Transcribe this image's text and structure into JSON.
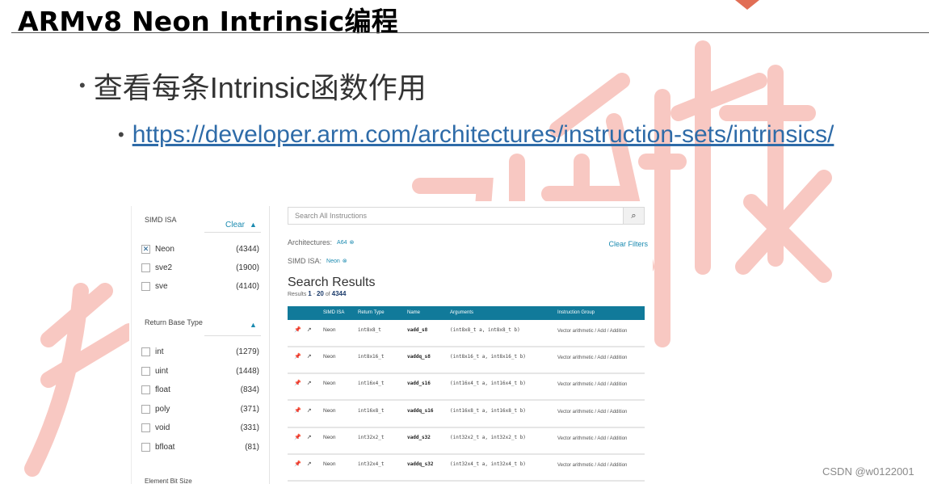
{
  "slide": {
    "title": "ARMv8 Neon Intrinsic编程",
    "bullet_1": "查看每条Intrinsic函数作用",
    "bullet_2_link": "https://developer.arm.com/architectures/instruction-sets/intrinsics/"
  },
  "watermark": {
    "csdn": "CSDN @w0122001"
  },
  "filters": {
    "simd_isa_label": "SIMD ISA",
    "clear_label": "Clear",
    "simd_items": [
      {
        "label": "Neon",
        "count": "(4344)",
        "checked": true
      },
      {
        "label": "sve2",
        "count": "(1900)",
        "checked": false
      },
      {
        "label": "sve",
        "count": "(4140)",
        "checked": false
      }
    ],
    "return_type_label": "Return Base Type",
    "return_items": [
      {
        "label": "int",
        "count": "(1279)"
      },
      {
        "label": "uint",
        "count": "(1448)"
      },
      {
        "label": "float",
        "count": "(834)"
      },
      {
        "label": "poly",
        "count": "(371)"
      },
      {
        "label": "void",
        "count": "(331)"
      },
      {
        "label": "bfloat",
        "count": "(81)"
      }
    ],
    "cut_label": "Element Bit Size"
  },
  "results": {
    "search_placeholder": "Search All Instructions",
    "architectures_label": "Architectures:",
    "arch_chip": "A64",
    "simd_label": "SIMD ISA:",
    "simd_chip": "Neon",
    "clear_filters": "Clear Filters",
    "title": "Search Results",
    "count_prefix": "Results",
    "count_from": "1",
    "count_dash": " - ",
    "count_to": "20",
    "count_of": " of ",
    "count_total": "4344",
    "columns": [
      "SIMD ISA",
      "Return Type",
      "Name",
      "Arguments",
      "Instruction Group"
    ],
    "rows": [
      {
        "isa": "Neon",
        "ret": "int8x8_t",
        "name": "vadd_s8",
        "args": "(int8x8_t a, int8x8_t b)",
        "group": "Vector arithmetic / Add / Addition"
      },
      {
        "isa": "Neon",
        "ret": "int8x16_t",
        "name": "vaddq_s8",
        "args": "(int8x16_t a, int8x16_t b)",
        "group": "Vector arithmetic / Add / Addition"
      },
      {
        "isa": "Neon",
        "ret": "int16x4_t",
        "name": "vadd_s16",
        "args": "(int16x4_t a, int16x4_t b)",
        "group": "Vector arithmetic / Add / Addition"
      },
      {
        "isa": "Neon",
        "ret": "int16x8_t",
        "name": "vaddq_s16",
        "args": "(int16x8_t a, int16x8_t b)",
        "group": "Vector arithmetic / Add / Addition"
      },
      {
        "isa": "Neon",
        "ret": "int32x2_t",
        "name": "vadd_s32",
        "args": "(int32x2_t a, int32x2_t b)",
        "group": "Vector arithmetic / Add / Addition"
      },
      {
        "isa": "Neon",
        "ret": "int32x4_t",
        "name": "vaddq_s32",
        "args": "(int32x4_t a, int32x4_t b)",
        "group": "Vector arithmetic / Add / Addition"
      }
    ]
  }
}
